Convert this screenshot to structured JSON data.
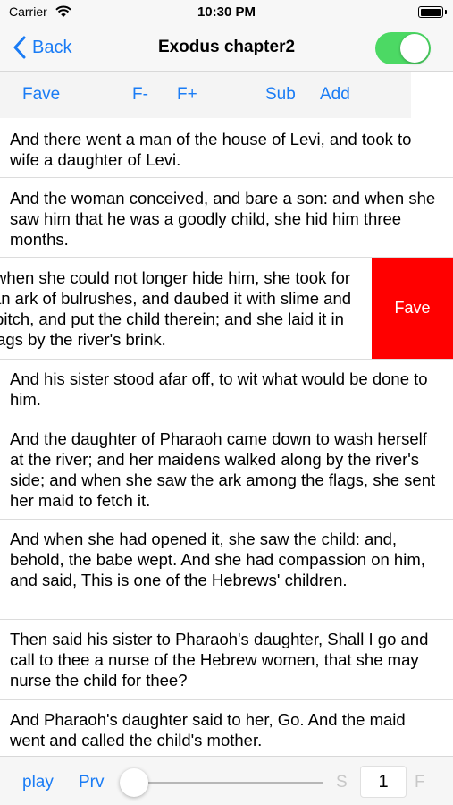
{
  "status_bar": {
    "carrier": "Carrier",
    "time": "10:30 PM",
    "battery_level": 1.0
  },
  "nav": {
    "back_label": "Back",
    "title": "Exodus chapter2",
    "toggle_on": true,
    "toggle_color": "#4cd964"
  },
  "toolbar": {
    "fave": "Fave",
    "font_minus": "F-",
    "font_plus": "F+",
    "sub": "Sub",
    "add": "Add"
  },
  "verses": [
    {
      "text": "And there went a man of the house of Levi, and took to wife a daughter of Levi."
    },
    {
      "text": "And the woman conceived, and bare a son: and when she saw him that he was a goodly child, she hid him three months."
    },
    {
      "text": "And when she could not longer hide him, she took for him an ark of bulrushes, and daubed it with slime and with pitch, and put the child therein; and she laid it in the flags by the river's brink.",
      "action_label": "Fave",
      "action_color": "#ff0000"
    },
    {
      "text": "And his sister stood afar off, to wit what would be done to him."
    },
    {
      "text": "And the daughter of Pharaoh came down to wash herself at the river; and her maidens walked along by the river's side; and when she saw the ark among the flags, she sent her maid to fetch it."
    },
    {
      "text": "And when she had opened it, she saw the child: and, behold, the babe wept. And she had compassion on him, and said, This is one of the Hebrews' children."
    },
    {
      "text": "Then said his sister to Pharaoh's daughter, Shall I go and call to thee a nurse of the Hebrew women, that she may nurse the child for thee?"
    },
    {
      "text": "And Pharaoh's daughter said to her, Go. And the maid went and called the child's mother."
    }
  ],
  "bottom_bar": {
    "play": "play",
    "prev": "Prv",
    "slider_value": 0,
    "start_label": "S",
    "page": "1",
    "end_label": "F"
  },
  "colors": {
    "accent": "#1a7cf5",
    "delete_red": "#ff0000",
    "toggle_green": "#4cd964"
  }
}
